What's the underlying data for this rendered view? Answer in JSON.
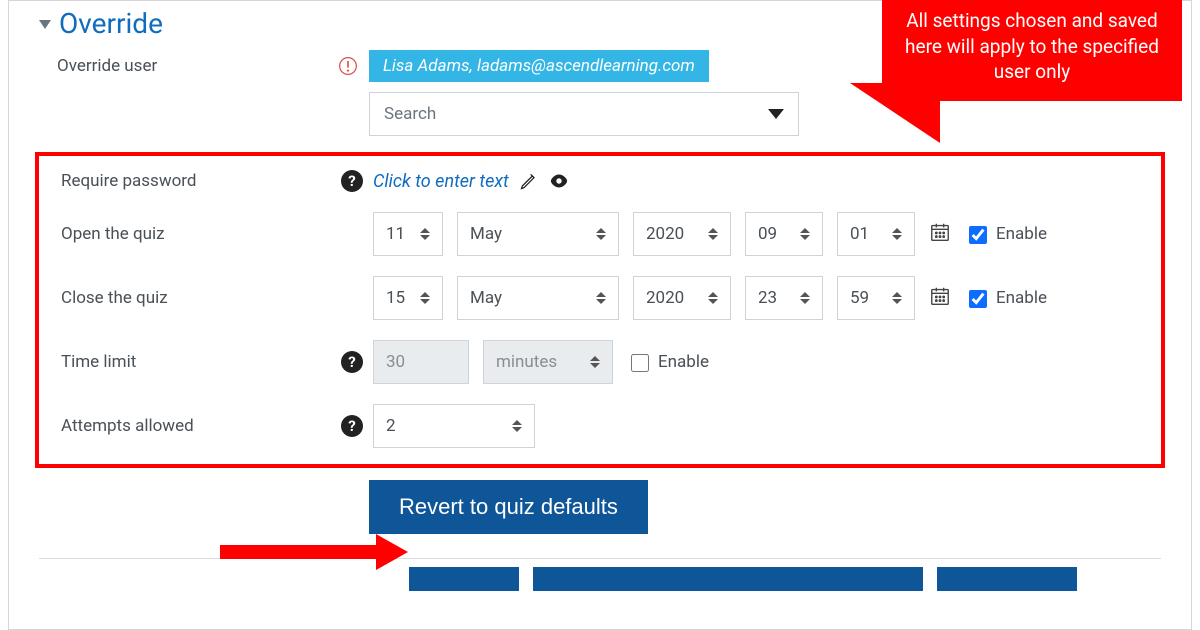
{
  "section": {
    "title": "Override"
  },
  "callout": {
    "text": "All settings chosen and saved here will apply to the specified user only"
  },
  "overrideUser": {
    "label": "Override user",
    "selected": "Lisa Adams, ladams@ascendlearning.com",
    "searchPlaceholder": "Search"
  },
  "password": {
    "label": "Require password",
    "action": "Click to enter text"
  },
  "openQuiz": {
    "label": "Open the quiz",
    "day": "11",
    "month": "May",
    "year": "2020",
    "hour": "09",
    "minute": "01",
    "enableLabel": "Enable",
    "enabled": true
  },
  "closeQuiz": {
    "label": "Close the quiz",
    "day": "15",
    "month": "May",
    "year": "2020",
    "hour": "23",
    "minute": "59",
    "enableLabel": "Enable",
    "enabled": true
  },
  "timeLimit": {
    "label": "Time limit",
    "value": "30",
    "unit": "minutes",
    "enableLabel": "Enable",
    "enabled": false
  },
  "attempts": {
    "label": "Attempts allowed",
    "value": "2"
  },
  "buttons": {
    "revert": "Revert to quiz defaults"
  }
}
